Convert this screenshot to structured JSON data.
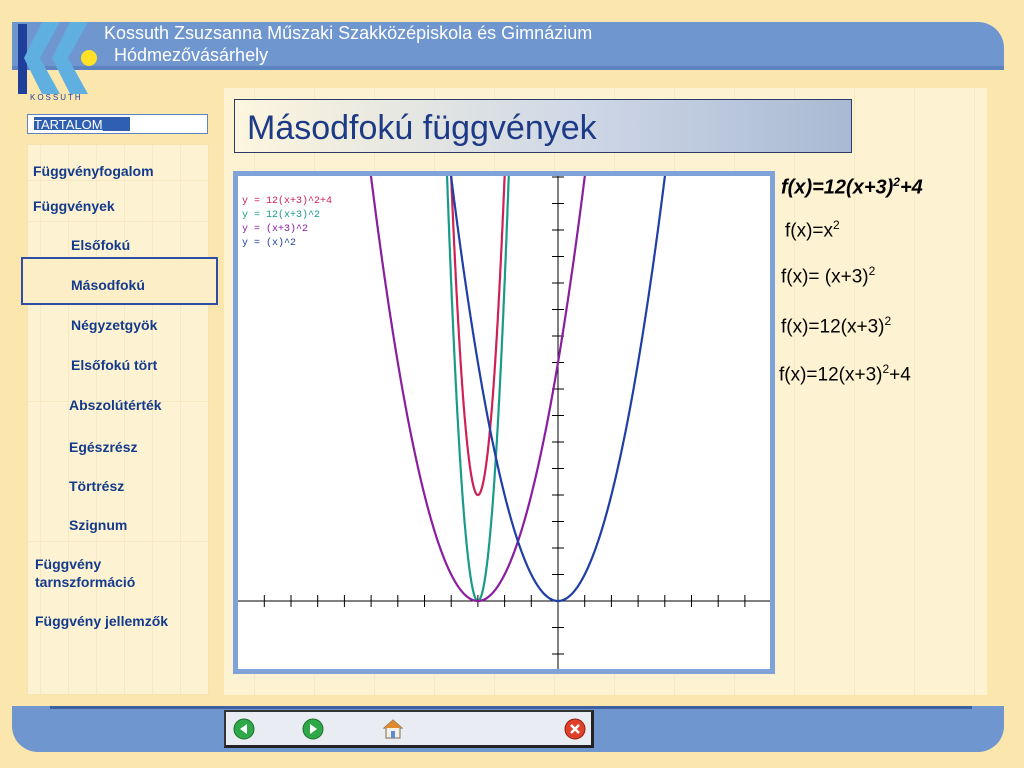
{
  "header": {
    "school_name": "Kossuth Zsuzsanna Műszaki Szakközépiskola és Gimnázium",
    "school_city": "Hódmezővásárhely",
    "logo_text": "KOSSUTH"
  },
  "sidebar": {
    "toc_label": "TARTALOM",
    "items": [
      {
        "label": "Függvényfogalom"
      },
      {
        "label": "Függvények"
      },
      {
        "label": "Elsőfokú"
      },
      {
        "label": "Másodfokú"
      },
      {
        "label": "Négyzetgyök"
      },
      {
        "label": "Elsőfokú tört"
      },
      {
        "label": "Abszolútérték"
      },
      {
        "label": "Egészrész"
      },
      {
        "label": "Törtrész"
      },
      {
        "label": "Szignum"
      },
      {
        "label": "Függvény tarnszformáció"
      },
      {
        "label": "Függvény jellemzők"
      }
    ],
    "active": "Másodfokú"
  },
  "main": {
    "title": "Másodfokú függvények",
    "formulas": {
      "main": {
        "prefix": "f(x)=12(x+3)",
        "exp": "2",
        "suffix": "+4"
      },
      "f1": {
        "prefix": "f(x)=x",
        "exp": "2",
        "suffix": ""
      },
      "f2": {
        "prefix": "f(x)= (x+3)",
        "exp": "2",
        "suffix": ""
      },
      "f3": {
        "prefix": "f(x)=12(x+3)",
        "exp": "2",
        "suffix": ""
      },
      "f4": {
        "prefix": "f(x)=12(x+3)",
        "exp": "2",
        "suffix": "+4"
      }
    }
  },
  "chart_data": {
    "type": "line",
    "legend_placement": "top-left",
    "series": [
      {
        "name": "y = 12(x+3)^2+4",
        "color": "#cc2255",
        "func": "12(x+3)^2+4"
      },
      {
        "name": "y = 12(x+3)^2",
        "color": "#1a9a8a",
        "func": "12(x+3)^2"
      },
      {
        "name": "y = (x+3)^2",
        "color": "#8a1ea0",
        "func": "(x+3)^2"
      },
      {
        "name": "y = (x)^2",
        "color": "#1f3fa6",
        "func": "x^2"
      }
    ],
    "xlim": [
      -11,
      8
    ],
    "ylim": [
      -3,
      17
    ],
    "grid": false
  },
  "footer": {
    "buttons": [
      {
        "name": "back",
        "icon": "arrow-left-icon",
        "color": "#2fa84a"
      },
      {
        "name": "forward",
        "icon": "arrow-right-icon",
        "color": "#2fa84a"
      },
      {
        "name": "home",
        "icon": "home-icon",
        "color": "#e08a30"
      },
      {
        "name": "exit",
        "icon": "close-icon",
        "color": "#e0402a"
      }
    ]
  }
}
